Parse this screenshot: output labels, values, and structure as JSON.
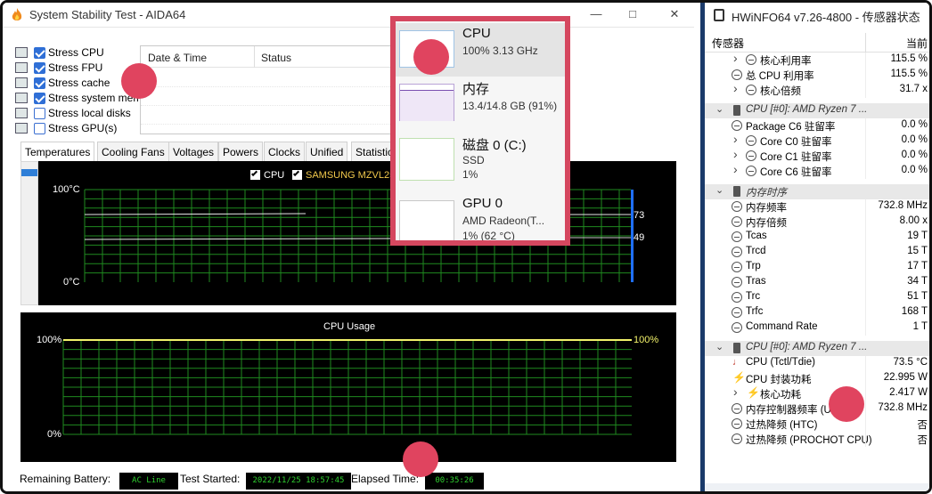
{
  "aida": {
    "title": "System Stability Test - AIDA64",
    "stress": [
      {
        "label": "Stress CPU",
        "checked": true
      },
      {
        "label": "Stress FPU",
        "checked": true
      },
      {
        "label": "Stress cache",
        "checked": true
      },
      {
        "label": "Stress system mem",
        "checked": true
      },
      {
        "label": "Stress local disks",
        "checked": false
      },
      {
        "label": "Stress GPU(s)",
        "checked": false
      }
    ],
    "log_headers": [
      "Date & Time",
      "Status"
    ],
    "tabs": [
      "Temperatures",
      "Cooling Fans",
      "Voltages",
      "Powers",
      "Clocks",
      "Unified",
      "Statistic"
    ],
    "temp_chart": {
      "legend": [
        "CPU",
        "SAMSUNG MZVL25"
      ],
      "y_top": "100°C",
      "y_bottom": "0°C",
      "readouts": [
        "73",
        "49"
      ]
    },
    "usage_chart": {
      "title": "CPU Usage",
      "y_top": "100%",
      "y_bottom": "0%",
      "readout": "100%"
    },
    "status": {
      "battery_label": "Remaining Battery:",
      "battery_value": "AC Line",
      "started_label": "Test Started:",
      "started_value": "2022/11/25 18:57:45",
      "elapsed_label": "Elapsed Time:",
      "elapsed_value": "00:35:26"
    }
  },
  "taskmgr": {
    "items": [
      {
        "name": "CPU",
        "detail1": "100%  3.13 GHz"
      },
      {
        "name": "内存",
        "detail1": "13.4/14.8 GB (91%)"
      },
      {
        "name": "磁盘 0 (C:)",
        "detail1": "SSD",
        "detail2": "1%"
      },
      {
        "name": "GPU 0",
        "detail1": "AMD Radeon(T...",
        "detail2": "1% (62 °C)"
      }
    ]
  },
  "hwinfo": {
    "title": "HWiNFO64 v7.26-4800 - 传感器状态",
    "col_sensor": "传感器",
    "col_current": "当前",
    "rows": [
      {
        "label": "核心利用率",
        "value": "115.5 %",
        "indent": 2,
        "chev": true
      },
      {
        "label": "总 CPU 利用率",
        "value": "115.5 %",
        "indent": 1
      },
      {
        "label": "核心倍频",
        "value": "31.7 x",
        "indent": 2,
        "chev": true
      },
      {
        "label": "",
        "value": "",
        "spacer": true
      },
      {
        "label": "CPU [#0]: AMD Ryzen 7 ...",
        "value": "",
        "group": true
      },
      {
        "label": "Package C6 驻留率",
        "value": "0.0 %",
        "indent": 1
      },
      {
        "label": "Core C0 驻留率",
        "value": "0.0 %",
        "indent": 2,
        "chev": true
      },
      {
        "label": "Core C1 驻留率",
        "value": "0.0 %",
        "indent": 2,
        "chev": true
      },
      {
        "label": "Core C6 驻留率",
        "value": "0.0 %",
        "indent": 2,
        "chev": true
      },
      {
        "label": "",
        "value": "",
        "spacer": true
      },
      {
        "label": "内存时序",
        "value": "",
        "group": true
      },
      {
        "label": "内存频率",
        "value": "732.8 MHz",
        "indent": 1
      },
      {
        "label": "内存倍频",
        "value": "8.00 x",
        "indent": 1
      },
      {
        "label": "Tcas",
        "value": "19 T",
        "indent": 1
      },
      {
        "label": "Trcd",
        "value": "15 T",
        "indent": 1
      },
      {
        "label": "Trp",
        "value": "17 T",
        "indent": 1
      },
      {
        "label": "Tras",
        "value": "34 T",
        "indent": 1
      },
      {
        "label": "Trc",
        "value": "51 T",
        "indent": 1
      },
      {
        "label": "Trfc",
        "value": "168 T",
        "indent": 1
      },
      {
        "label": "Command Rate",
        "value": "1 T",
        "indent": 1
      },
      {
        "label": "",
        "value": "",
        "spacer": true
      },
      {
        "label": "CPU [#0]: AMD Ryzen 7 ...",
        "value": "",
        "group": true
      },
      {
        "label": "CPU (Tctl/Tdie)",
        "value": "73.5 °C",
        "indent": 1,
        "icon": "thermometer"
      },
      {
        "label": "CPU 封装功耗",
        "value": "22.995 W",
        "indent": 1,
        "icon": "bolt"
      },
      {
        "label": "核心功耗",
        "value": "2.417 W",
        "indent": 2,
        "chev": true,
        "icon": "bolt"
      },
      {
        "label": "内存控制器频率 (UCLK)",
        "value": "732.8 MHz",
        "indent": 1
      },
      {
        "label": "过热降频 (HTC)",
        "value": "否",
        "indent": 1
      },
      {
        "label": "过热降频 (PROCHOT CPU)",
        "value": "否",
        "indent": 1
      }
    ]
  },
  "colors": {
    "accent": "#2f6fd6",
    "popup_border": "#d5475f",
    "grid": "#1f8a1f",
    "lcd_text": "#2fd12f"
  }
}
